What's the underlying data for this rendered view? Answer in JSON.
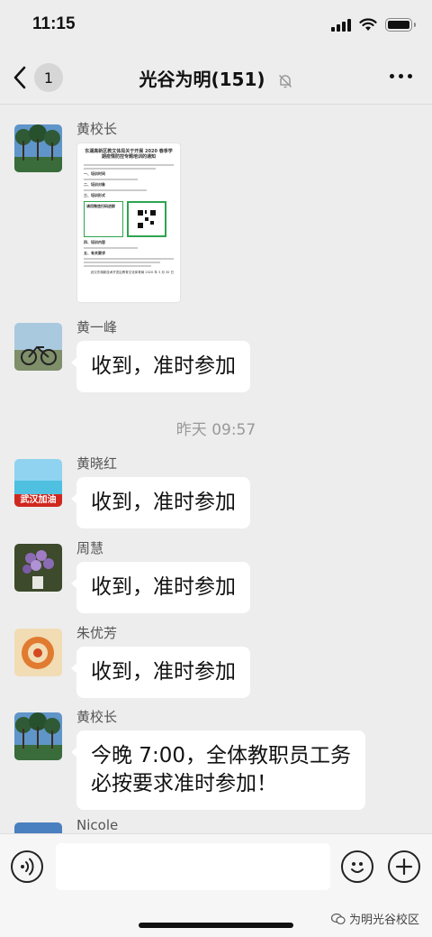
{
  "status_bar": {
    "time": "11:15"
  },
  "nav": {
    "back_count": "1",
    "title": "光谷为明(151)"
  },
  "messages": [
    {
      "sender": "黄校长",
      "type": "image",
      "doc": {
        "title": "东湖高新区教文体局关于开展 2020 春季学期疫情防控专题培训的通知",
        "section1": "一、培训时间",
        "section2": "二、培训对象",
        "section3": "三、培训形式",
        "qr_text": "请用微信扫码进群",
        "section4": "四、培训内容",
        "section5": "五、有关要求",
        "footer": "武汉东湖新技术开发区教育文化体育局 2020 年 3 月 30 日"
      }
    },
    {
      "sender": "黄一峰",
      "type": "text",
      "text": "收到，准时参加"
    },
    {
      "sender": "黄晓红",
      "type": "text",
      "text": "收到，准时参加",
      "avatar_badge": "武汉加油"
    },
    {
      "sender": "周慧",
      "type": "text",
      "text": "收到，准时参加"
    },
    {
      "sender": "朱优芳",
      "type": "text",
      "text": "收到，准时参加"
    },
    {
      "sender": "黄校长",
      "type": "text",
      "text_line1": "今晚 7:00，全体教职员工务",
      "text_line2": "必按要求准时参加！"
    },
    {
      "sender": "Nicole",
      "type": "text"
    }
  ],
  "time_divider": "昨天 09:57",
  "watermark": "为明光谷校区",
  "icons": {
    "back": "chevron-left-icon",
    "mute": "bell-slash-icon",
    "more": "more-dots-icon",
    "voice": "voice-icon",
    "emoji": "emoji-icon",
    "plus": "plus-icon"
  }
}
